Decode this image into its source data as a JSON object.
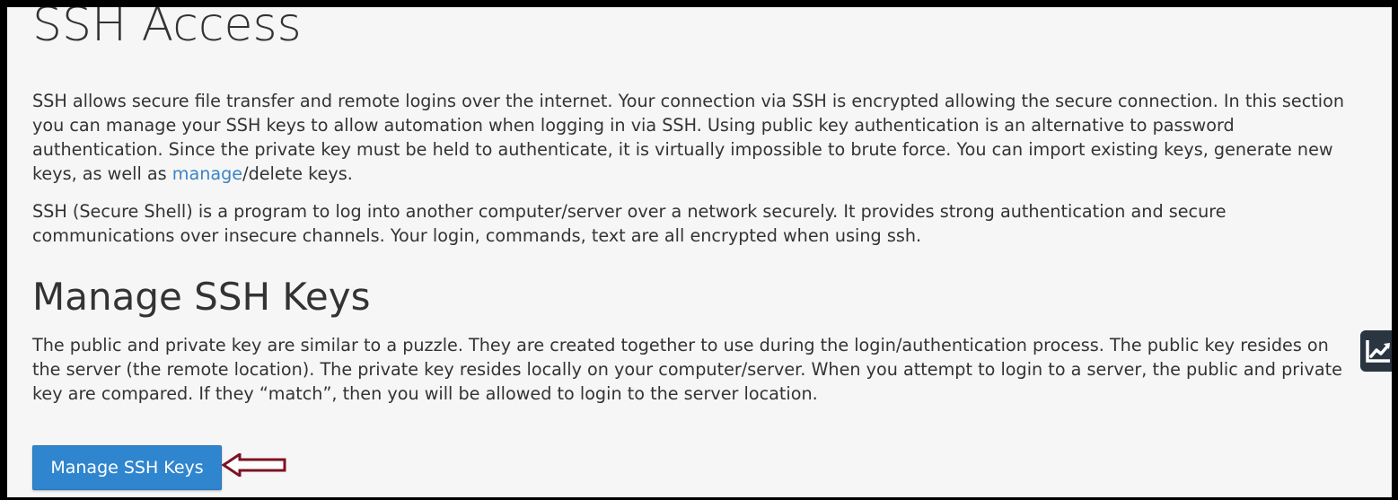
{
  "page": {
    "title": "SSH Access"
  },
  "intro": {
    "p1_before_link": "SSH allows secure file transfer and remote logins over the internet. Your connection via SSH is encrypted allowing the secure connection. In this section you can manage your SSH keys to allow automation when logging in via SSH. Using public key authentication is an alternative to password authentication. Since the private key must be held to authenticate, it is virtually impossible to brute force. You can import existing keys, generate new keys, as well as ",
    "p1_link": "manage",
    "p1_after_link": "/delete keys.",
    "p2": "SSH (Secure Shell) is a program to log into another computer/server over a network securely. It provides strong authentication and secure communications over insecure channels. Your login, commands, text are all encrypted when using ssh."
  },
  "manage_section": {
    "title": "Manage SSH Keys",
    "description": "The public and private key are similar to a puzzle. They are created together to use during the login/authentication process. The public key resides on the server (the remote location). The private key resides locally on your computer/server. When you attempt to login to a server, the public and private key are compared. If they “match”, then you will be allowed to login to the server location.",
    "button_label": "Manage SSH Keys"
  },
  "annotation": {
    "arrow_icon": "left-arrow-icon",
    "arrow_color": "#7d1222"
  },
  "side_widget": {
    "icon": "trend-chart-icon",
    "background": "#2a3541"
  },
  "colors": {
    "background": "#f6f6f6",
    "text": "#333333",
    "link": "#3d84c6",
    "button": "#2f86cf"
  }
}
